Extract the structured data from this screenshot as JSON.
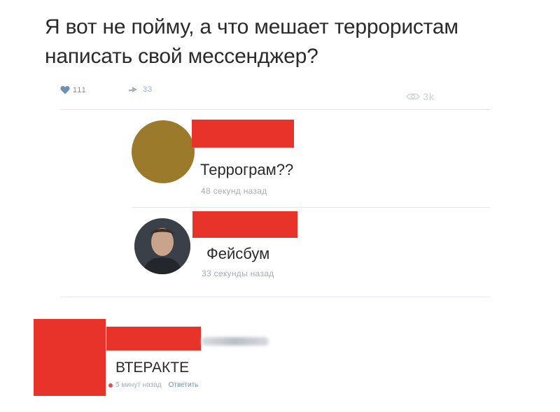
{
  "post": {
    "text_line1": "Я вот не пойму, а что мешает террористам",
    "text_line2": "написать свой мессенджер?",
    "likes": "111",
    "shares": "33",
    "views": "3k"
  },
  "comments": [
    {
      "text": "Террограм??",
      "time": "48 секунд назад",
      "avatar_color": "#9b7a2c"
    },
    {
      "text": "Фейсбум",
      "time": "33 секунды назад"
    },
    {
      "text": "ВТЕРАКТЕ",
      "time": "5 минут назад",
      "reply_label": "Ответить"
    }
  ],
  "colors": {
    "redaction": "#e8332a",
    "link": "#6d8fb5",
    "divider": "#e3e6ea"
  },
  "icons": [
    "heart-icon",
    "share-icon",
    "eye-icon"
  ]
}
